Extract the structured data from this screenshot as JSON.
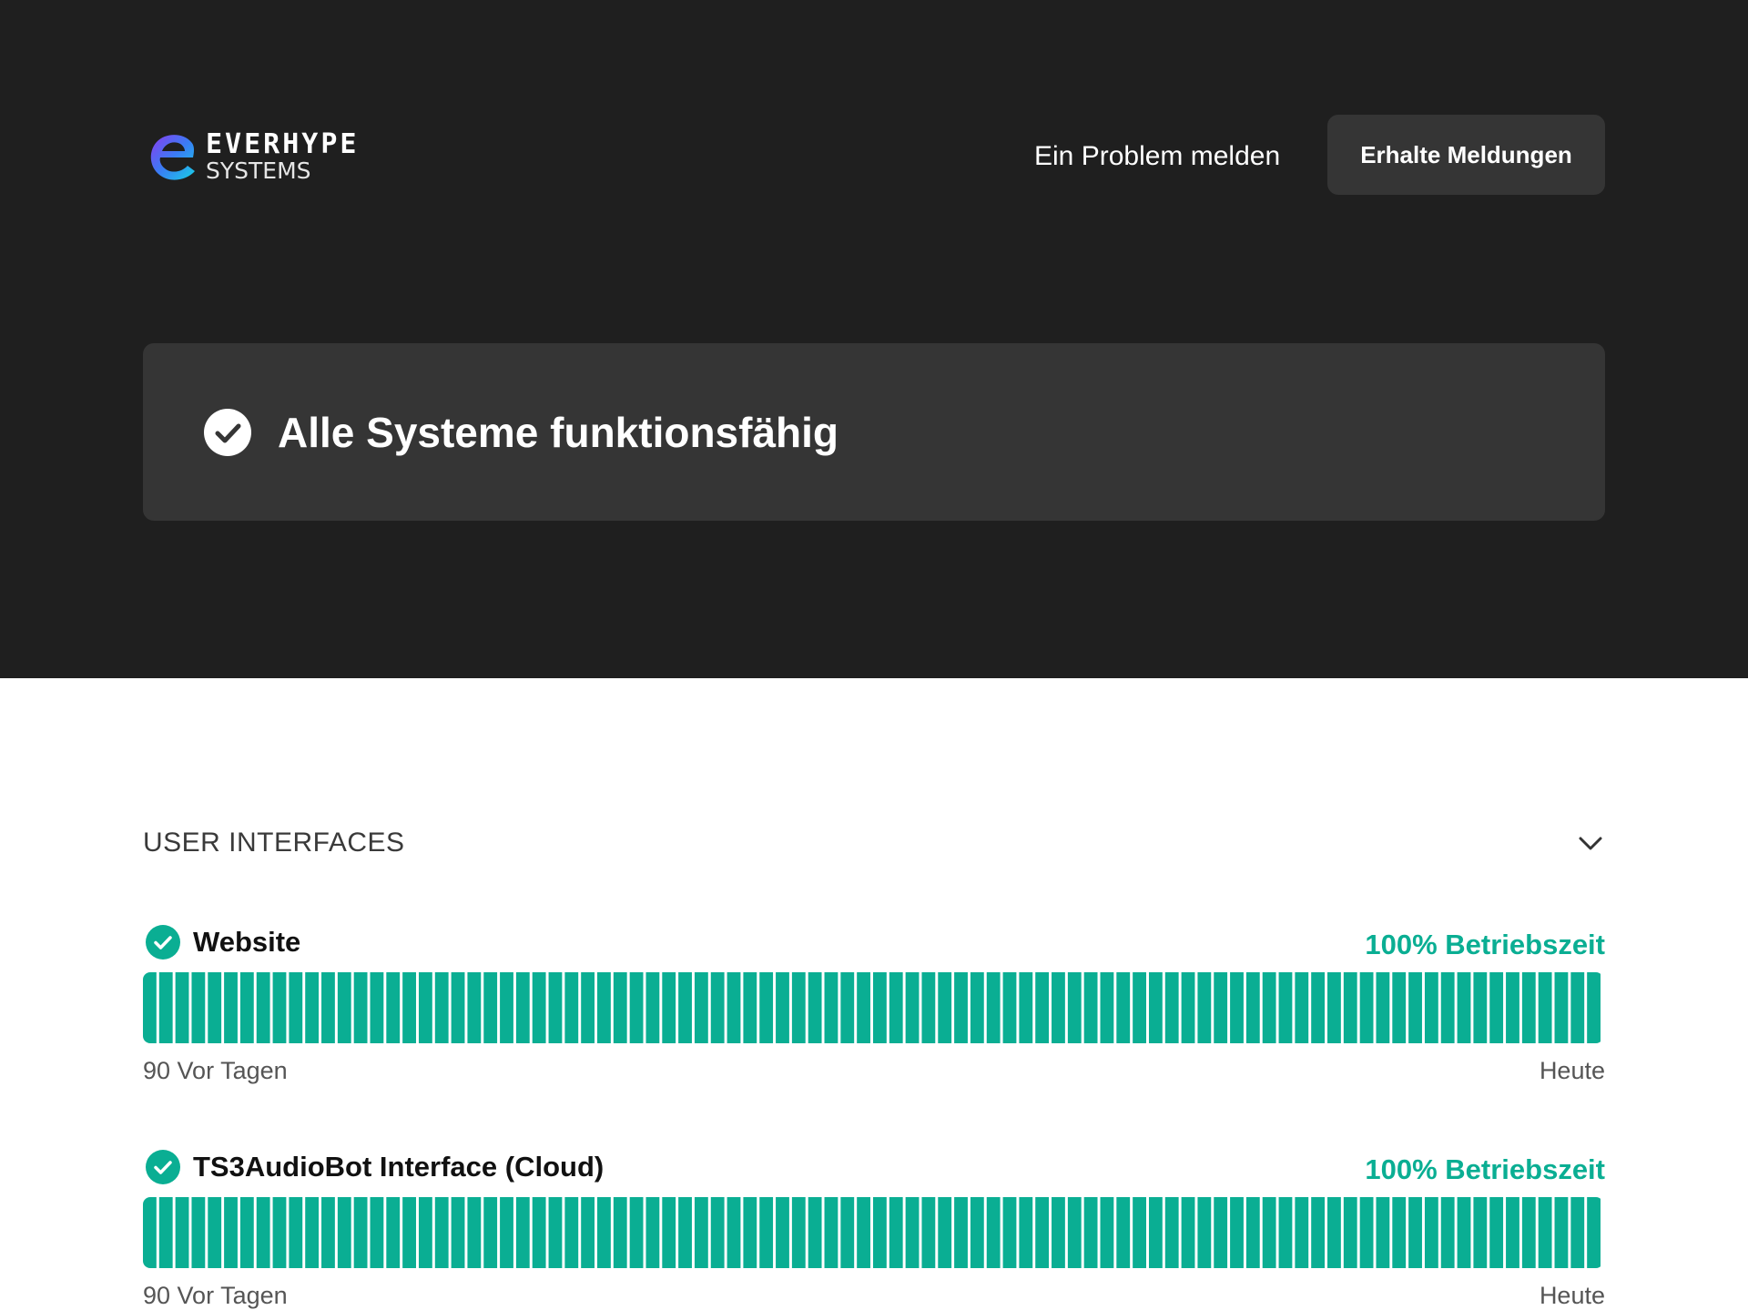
{
  "header": {
    "logo": {
      "wordmark_top": "EVERHYPE",
      "wordmark_bottom": "SYSTEMS"
    },
    "report_problem_label": "Ein Problem melden",
    "subscribe_label": "Erhalte Meldungen"
  },
  "status": {
    "message": "Alle Systeme funktionsfähig",
    "icon": "check-circle-icon"
  },
  "groups": [
    {
      "title": "USER INTERFACES",
      "collapse_icon": "chevron-down-icon",
      "components": [
        {
          "name": "Website",
          "uptime_label": "100% Betriebszeit",
          "days": 90,
          "range_start": "90 Vor Tagen",
          "range_end": "Heute"
        },
        {
          "name": "TS3AudioBot Interface (Cloud)",
          "uptime_label": "100% Betriebszeit",
          "days": 90,
          "range_start": "90 Vor Tagen",
          "range_end": "Heute"
        }
      ]
    }
  ],
  "colors": {
    "hero_bg": "#1f1f1f",
    "panel_bg": "#353535",
    "operational": "#0aae93",
    "text_dark": "#111111"
  }
}
